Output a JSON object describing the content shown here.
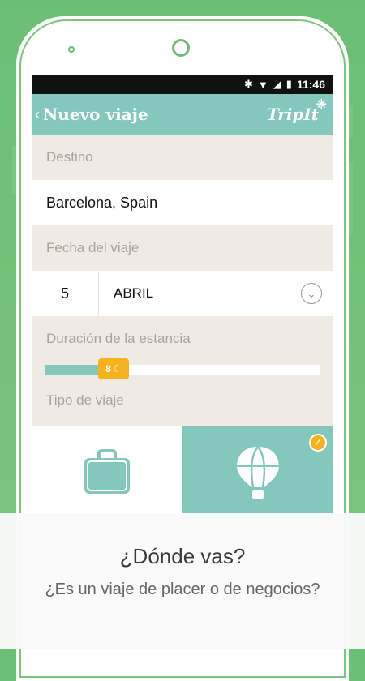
{
  "status_bar": {
    "time": "11:46",
    "icons": [
      "bluetooth-icon",
      "wifi-icon",
      "signal-icon",
      "battery-icon"
    ]
  },
  "app_bar": {
    "back_icon": "chevron-left-icon",
    "title": "Nuevo viaje",
    "logo_text": "TripIt"
  },
  "form": {
    "destination_label": "Destino",
    "destination_value": "Barcelona, Spain",
    "date_label": "Fecha del viaje",
    "date_day": "5",
    "date_month": "ABRIL",
    "duration_label": "Duración de la estancia",
    "duration_nights": "8",
    "duration_fraction": 0.25,
    "trip_type_label": "Tipo de viaje",
    "trip_types": [
      {
        "name": "business",
        "icon": "briefcase-icon",
        "selected": false
      },
      {
        "name": "leisure",
        "icon": "hot-air-balloon-icon",
        "selected": true
      }
    ]
  },
  "overlay": {
    "title": "¿Dónde vas?",
    "subtitle": "¿Es un viaje de placer o de negocios?"
  },
  "colors": {
    "background": "#6bbf74",
    "teal": "#84c7bc",
    "accent": "#f5b21c"
  }
}
